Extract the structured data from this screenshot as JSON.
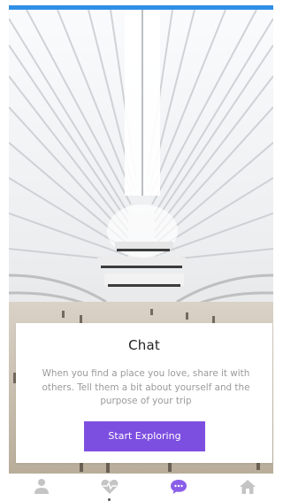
{
  "hero": {
    "image_desc": "Interior of a white-ribbed architectural hall with crowds below"
  },
  "card": {
    "title": "Chat",
    "body": "When you find a place you love, share it with others. Tell them a bit about yourself and the purpose of your trip",
    "cta_label": "Start Exploring"
  },
  "colors": {
    "topbar": "#2f8fe6",
    "accent": "#7d4fe0",
    "tab_inactive": "#c4c4c4",
    "tab_active": "#8a5ee8"
  },
  "tabs": [
    {
      "icon": "profile-icon",
      "active": false
    },
    {
      "icon": "heart-pulse-icon",
      "active": false
    },
    {
      "icon": "chat-icon",
      "active": true
    },
    {
      "icon": "home-icon",
      "active": false
    }
  ]
}
